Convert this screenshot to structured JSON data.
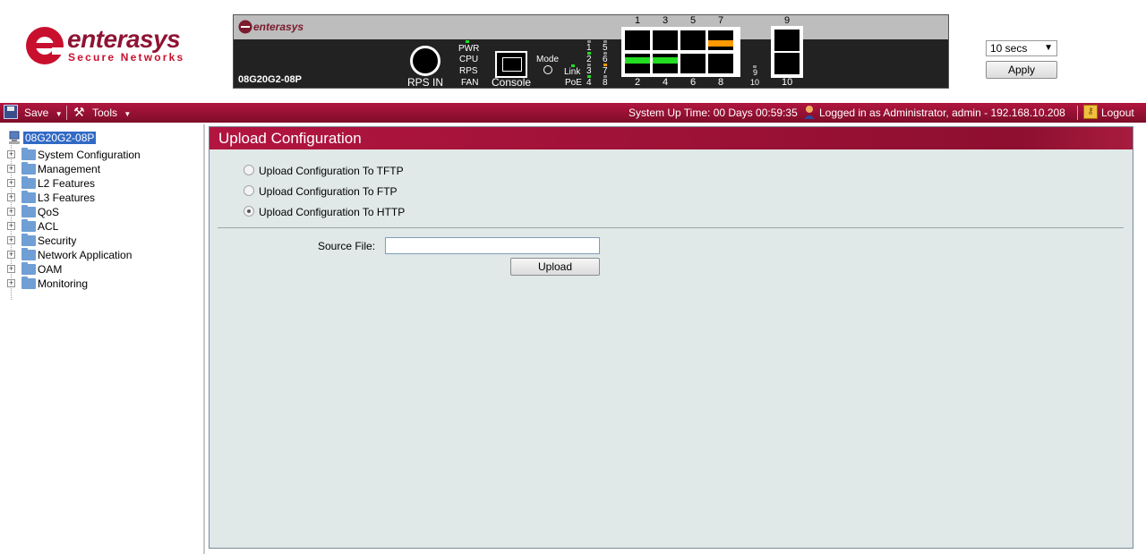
{
  "header": {
    "logo_word": "enterasys",
    "logo_tagline": "Secure Networks",
    "panel": {
      "brand": "enterasys",
      "model": "08G20G2-08P",
      "rps_label": "RPS IN",
      "led_labels": [
        "PWR",
        "CPU",
        "RPS",
        "FAN"
      ],
      "console_label": "Console",
      "mode_label": "Mode",
      "link_label": "Link",
      "poe_label": "PoE",
      "led_numbers_a": [
        "1",
        "2",
        "3",
        "4"
      ],
      "led_numbers_b": [
        "5",
        "6",
        "7",
        "8"
      ],
      "led_numbers_c": [
        "9",
        "10"
      ],
      "port_numbers_top": [
        "1",
        "3",
        "5",
        "7"
      ],
      "port_numbers_bottom": [
        "2",
        "4",
        "6",
        "8"
      ],
      "sfp_top": "9",
      "sfp_bottom": "10"
    },
    "refresh": {
      "selected": "10 secs",
      "apply_label": "Apply"
    }
  },
  "toolbar": {
    "save_label": "Save",
    "tools_label": "Tools",
    "uptime": "System Up Time: 00 Days 00:59:35",
    "login_info": "Logged in as Administrator, admin - 192.168.10.208",
    "logout_label": "Logout"
  },
  "sidebar": {
    "root_label": "08G20G2-08P",
    "items": [
      {
        "label": "System Configuration"
      },
      {
        "label": "Management"
      },
      {
        "label": "L2 Features"
      },
      {
        "label": "L3 Features"
      },
      {
        "label": "QoS"
      },
      {
        "label": "ACL"
      },
      {
        "label": "Security"
      },
      {
        "label": "Network Application"
      },
      {
        "label": "OAM"
      },
      {
        "label": "Monitoring"
      }
    ]
  },
  "main": {
    "title": "Upload Configuration",
    "options": [
      {
        "label": "Upload Configuration To TFTP",
        "checked": false
      },
      {
        "label": "Upload Configuration To FTP",
        "checked": false
      },
      {
        "label": "Upload Configuration To HTTP",
        "checked": true
      }
    ],
    "source_file_label": "Source File:",
    "source_file_value": "",
    "upload_label": "Upload"
  },
  "colors": {
    "accent": "#9e1237",
    "content_bg": "#e0e8e8",
    "led_green": "#22dd22",
    "port_amber": "#ff9900"
  }
}
